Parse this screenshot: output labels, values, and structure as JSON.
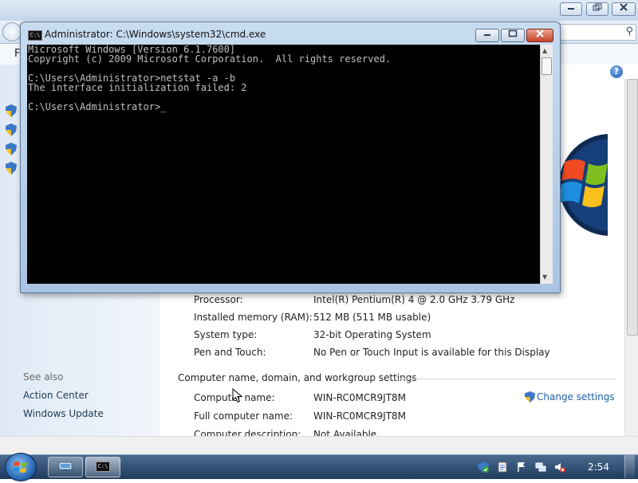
{
  "background_window": {
    "menu_first_letter": "F",
    "see_also": {
      "heading": "See also",
      "links": [
        "Action Center",
        "Windows Update"
      ]
    },
    "system": {
      "rows": [
        {
          "label": "Processor:",
          "value": "Intel(R) Pentium(R) 4   @ 2.0 GHz  3.79 GHz"
        },
        {
          "label": "Installed memory (RAM):",
          "value": "512 MB (511 MB usable)"
        },
        {
          "label": "System type:",
          "value": "32-bit Operating System"
        },
        {
          "label": "Pen and Touch:",
          "value": "No Pen or Touch Input is available for this Display"
        }
      ]
    },
    "computer_name_section": {
      "header": "Computer name, domain, and workgroup settings",
      "change_settings": "Change settings",
      "rows": [
        {
          "label": "Computer name:",
          "value": "WIN-RC0MCR9JT8M"
        },
        {
          "label": "Full computer name:",
          "value": "WIN-RC0MCR9JT8M"
        },
        {
          "label": "Computer description:",
          "value": "Not Available"
        }
      ]
    }
  },
  "cmd_window": {
    "title": "Administrator: C:\\Windows\\system32\\cmd.exe",
    "icon_text": "C:\\",
    "lines": [
      "Microsoft Windows [Version 6.1.7600]",
      "Copyright (c) 2009 Microsoft Corporation.  All rights reserved.",
      "",
      "C:\\Users\\Administrator>netstat -a -b",
      "The interface initialization failed: 2",
      "",
      "C:\\Users\\Administrator>"
    ],
    "cursor": "_"
  },
  "taskbar": {
    "clock": "2:54",
    "cmd_icon_text": "C:\\"
  },
  "colors": {
    "console_text": "#c0c0c0",
    "console_bg": "#000000",
    "taskbar": "#1f3b5e",
    "link": "#1f5fa8"
  }
}
